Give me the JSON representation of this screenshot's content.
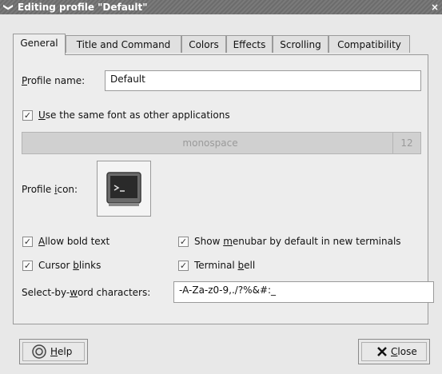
{
  "window": {
    "title": "Editing profile \"Default\"",
    "menu_glyph": "❯",
    "close_glyph": "×"
  },
  "tabs": [
    {
      "label": "General",
      "active": true
    },
    {
      "label": "Title and Command",
      "active": false
    },
    {
      "label": "Colors",
      "active": false
    },
    {
      "label": "Effects",
      "active": false
    },
    {
      "label": "Scrolling",
      "active": false
    },
    {
      "label": "Compatibility",
      "active": false
    }
  ],
  "general": {
    "profile_name_label_mnemonic": "P",
    "profile_name_label_rest": "rofile name:",
    "profile_name_value": "Default",
    "use_system_font": {
      "mnemonic": "U",
      "rest": "se the same font as other applications",
      "checked": true
    },
    "font_name": "monospace",
    "font_size": "12",
    "profile_icon_label_before": "Profile ",
    "profile_icon_label_mnemonic": "i",
    "profile_icon_label_after": "con:",
    "allow_bold": {
      "mnemonic": "A",
      "rest": "llow bold text",
      "checked": true
    },
    "cursor_blinks": {
      "before": "Cursor ",
      "mnemonic": "b",
      "rest": "links",
      "checked": true
    },
    "show_menubar": {
      "before": "Show ",
      "mnemonic": "m",
      "rest": "enubar by default in new terminals",
      "checked": true
    },
    "terminal_bell": {
      "before": "Terminal ",
      "mnemonic": "b",
      "rest": "ell",
      "checked": true
    },
    "word_chars_label_before": "Select-by-",
    "word_chars_label_mnemonic": "w",
    "word_chars_label_after": "ord characters:",
    "word_chars_value": "-A-Za-z0-9,./?%&#:_"
  },
  "buttons": {
    "help": {
      "mnemonic": "H",
      "rest": "elp"
    },
    "close": {
      "mnemonic": "C",
      "rest": "lose"
    }
  },
  "check_glyph": "✓",
  "colors": {
    "titlebar": "#6c6c6c",
    "dialog_bg": "#e8e8e8",
    "panel_bg": "#ededed"
  }
}
